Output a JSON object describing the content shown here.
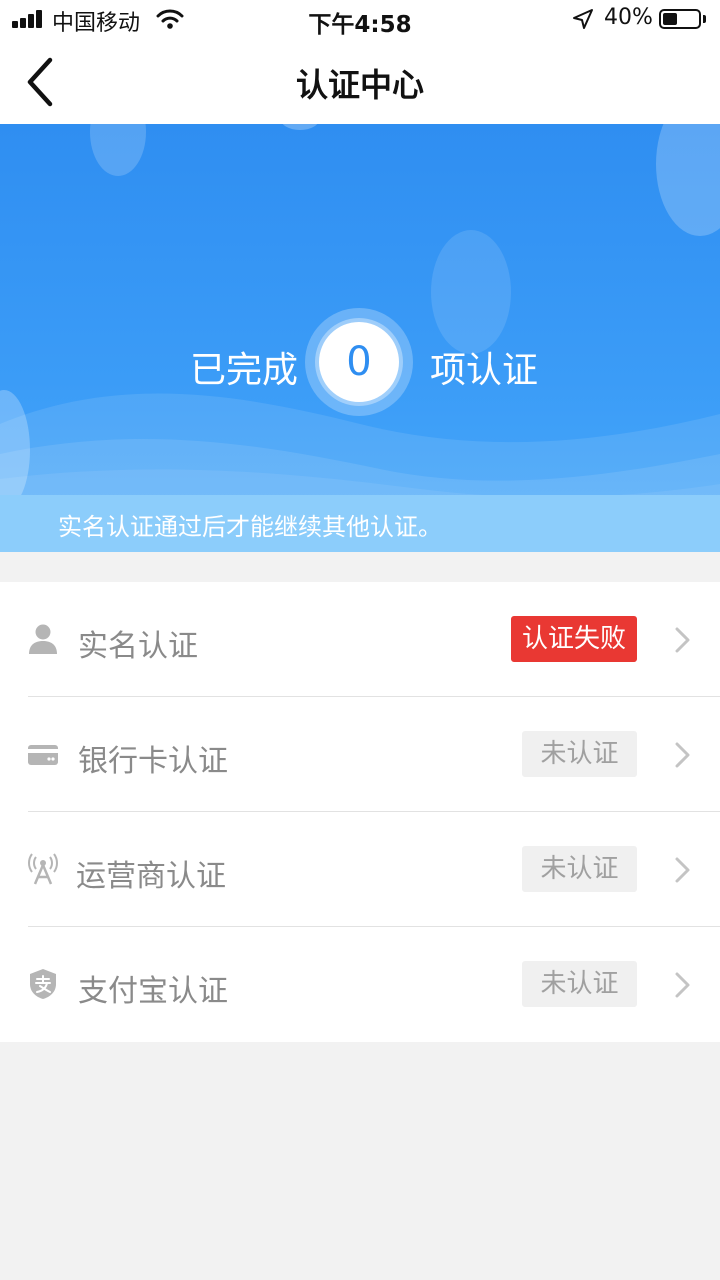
{
  "status_bar": {
    "carrier": "中国移动",
    "time": "下午4:58",
    "battery_percent": "40%",
    "battery_level": 0.4
  },
  "nav": {
    "title": "认证中心",
    "back_icon": "chevron-left-icon"
  },
  "banner": {
    "prefix": "已完成",
    "count": "0",
    "suffix": "项认证",
    "notice": "实名认证通过后才能继续其他认证。"
  },
  "items": [
    {
      "label": "实名认证",
      "icon": "person-icon",
      "status": "认证失败",
      "status_type": "failed"
    },
    {
      "label": "银行卡认证",
      "icon": "bank-card-icon",
      "status": "未认证",
      "status_type": "pending"
    },
    {
      "label": "运营商认证",
      "icon": "signal-tower-icon",
      "status": "未认证",
      "status_type": "pending"
    },
    {
      "label": "支付宝认证",
      "icon": "alipay-shield-icon",
      "status": "未认证",
      "status_type": "pending"
    }
  ],
  "colors": {
    "primary": "#2f8ef1",
    "failed": "#e93833",
    "notice_bg": "#8ccdfb"
  }
}
